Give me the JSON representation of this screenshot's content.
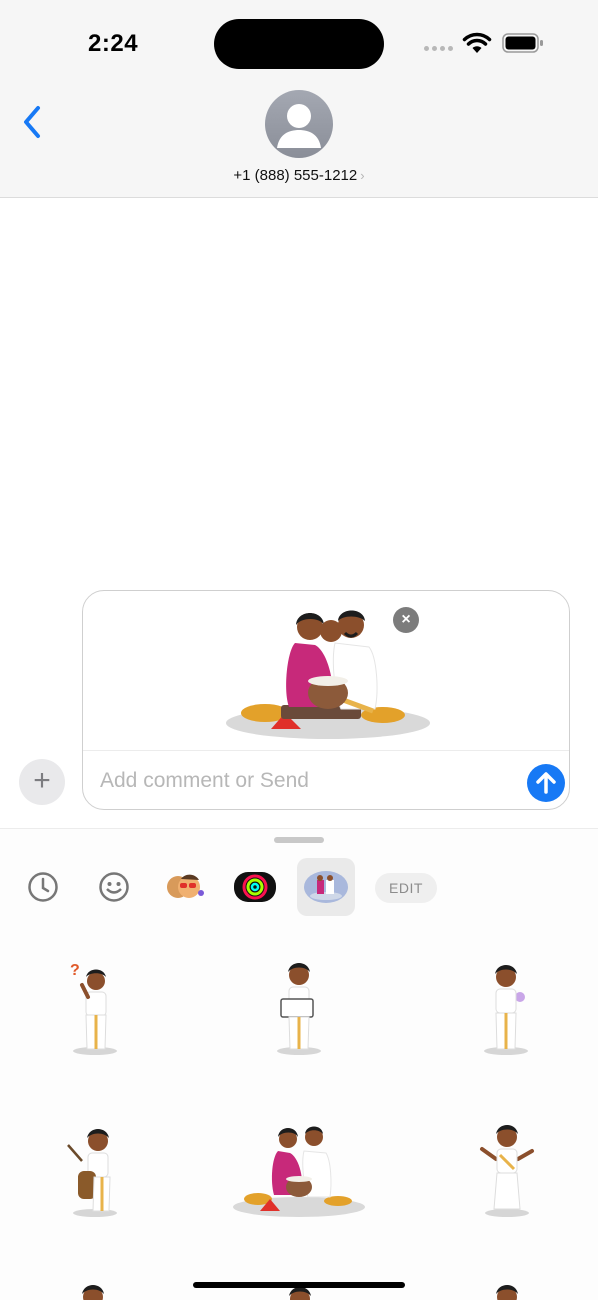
{
  "status_bar": {
    "time": "2:24"
  },
  "header": {
    "contact": "+1 (888) 555-1212",
    "chevron": "›"
  },
  "compose": {
    "remove_glyph": "×",
    "comment_placeholder": "Add comment or Send",
    "plus_glyph": "+"
  },
  "drawer": {
    "apps": [
      {
        "icon": "recents-clock-icon"
      },
      {
        "icon": "emoji-icon"
      },
      {
        "icon": "memoji-icon"
      },
      {
        "icon": "activity-rings-icon"
      },
      {
        "icon": "sticker-pack-icon",
        "selected": true
      }
    ],
    "edit_label": "EDIT"
  },
  "colors": {
    "accent": "#1779f5",
    "saree": "#c7297a",
    "mundu_gold": "#e8b34a",
    "skin": "#8b4f2c"
  }
}
